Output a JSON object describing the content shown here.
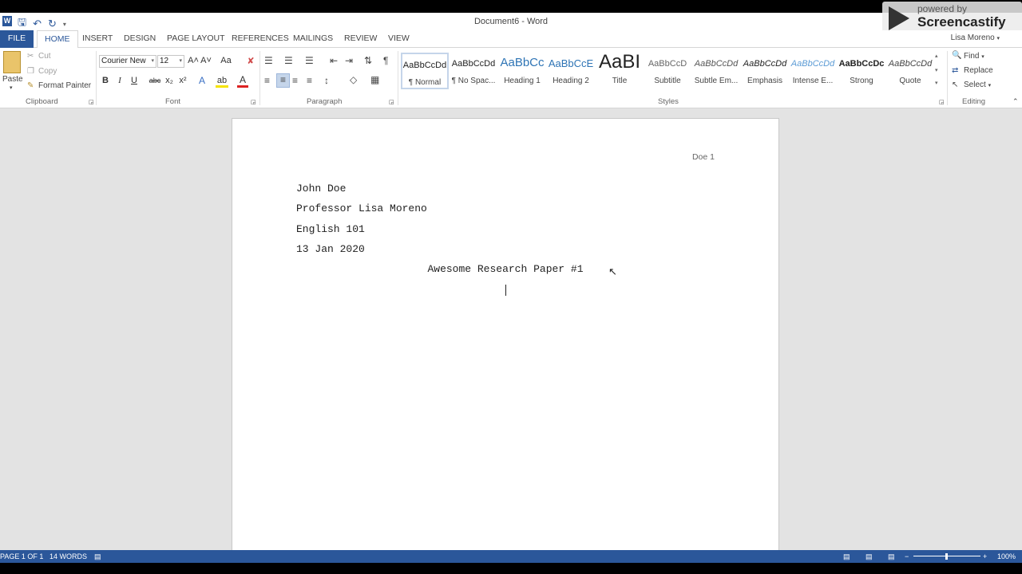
{
  "window": {
    "title": "Document6 - Word",
    "user": "Lisa Moreno"
  },
  "tabs": [
    "FILE",
    "HOME",
    "INSERT",
    "DESIGN",
    "PAGE LAYOUT",
    "REFERENCES",
    "MAILINGS",
    "REVIEW",
    "VIEW"
  ],
  "clipboard": {
    "paste": "Paste",
    "cut": "Cut",
    "copy": "Copy",
    "format_painter": "Format Painter",
    "label": "Clipboard"
  },
  "font": {
    "family": "Courier New",
    "size": "12",
    "label": "Font",
    "bold": "B",
    "italic": "I",
    "underline": "U",
    "strike": "abc",
    "sub": "x₂",
    "sup": "x²",
    "grow": "A˄",
    "shrink": "A˅",
    "case": "Aa",
    "text_effects": "A",
    "highlight": "ab",
    "font_color": "A"
  },
  "paragraph": {
    "label": "Paragraph",
    "pilcrow": "¶"
  },
  "styles": {
    "label": "Styles",
    "items": [
      {
        "sample": "AaBbCcDd",
        "label": "¶ Normal"
      },
      {
        "sample": "AaBbCcDd",
        "label": "¶ No Spac..."
      },
      {
        "sample": "AaBbCc",
        "label": "Heading 1"
      },
      {
        "sample": "AaBbCcE",
        "label": "Heading 2"
      },
      {
        "sample": "AaBI",
        "label": "Title"
      },
      {
        "sample": "AaBbCcD",
        "label": "Subtitle"
      },
      {
        "sample": "AaBbCcDd",
        "label": "Subtle Em..."
      },
      {
        "sample": "AaBbCcDd",
        "label": "Emphasis"
      },
      {
        "sample": "AaBbCcDd",
        "label": "Intense E..."
      },
      {
        "sample": "AaBbCcDc",
        "label": "Strong"
      },
      {
        "sample": "AaBbCcDd",
        "label": "Quote"
      }
    ]
  },
  "editing": {
    "find": "Find",
    "replace": "Replace",
    "select": "Select",
    "label": "Editing"
  },
  "document": {
    "header": "Doe 1",
    "lines": [
      "John Doe",
      "Professor Lisa Moreno",
      "English 101",
      "13 Jan 2020"
    ],
    "title": "Awesome Research Paper #1"
  },
  "status": {
    "page": "PAGE 1 OF 1",
    "words": "14 WORDS",
    "zoom": "100%"
  },
  "watermark": {
    "powered": "powered by",
    "brand": "Screencastify"
  },
  "colors": {
    "accent": "#2b579a"
  }
}
